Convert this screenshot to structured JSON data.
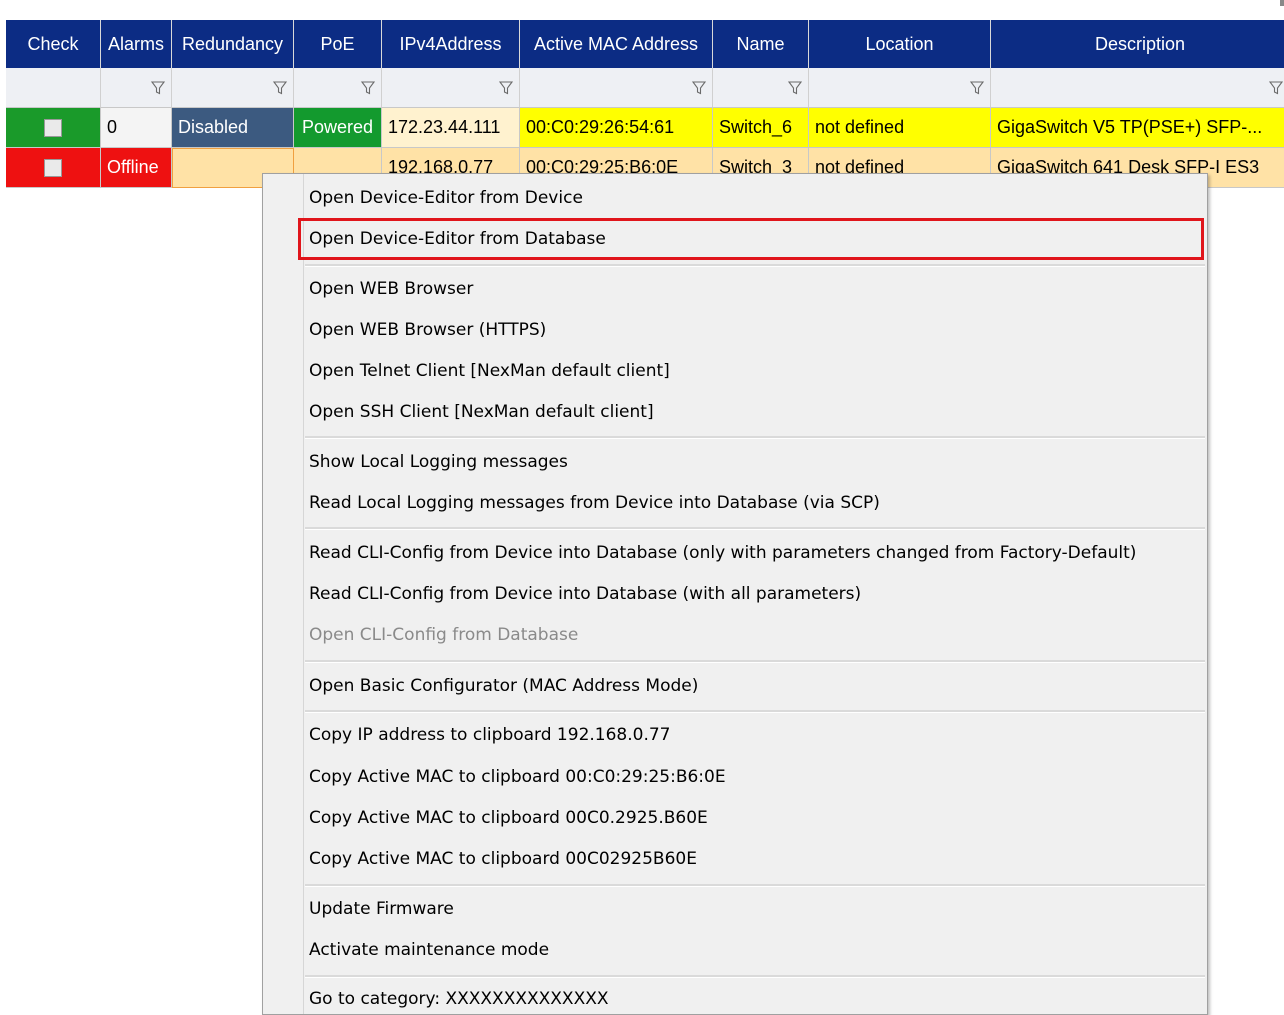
{
  "grid": {
    "columns": [
      "Check",
      "Alarms",
      "Redundancy",
      "PoE",
      "IPv4Address",
      "Active MAC Address",
      "Name",
      "Location",
      "Description"
    ],
    "rows": [
      {
        "alarms": "0",
        "redundancy": "Disabled",
        "poe": "Powered",
        "ip": "172.23.44.111",
        "mac": "00:C0:29:26:54:61",
        "name": "Switch_6",
        "location": "not defined",
        "description": "GigaSwitch V5 TP(PSE+) SFP-..."
      },
      {
        "alarms": "Offline",
        "redundancy": "",
        "poe": "",
        "ip": "192.168.0.77",
        "mac": "00:C0:29:25:B6:0E",
        "name": "Switch_3",
        "location": "not defined",
        "description": "GigaSwitch 641 Desk SFP-I ES3"
      }
    ],
    "colors": {
      "header_bg": "#0c2c84",
      "online_green": "#1a9a2a",
      "offline_red": "#ee1111",
      "highlight_yellow": "#ffff00",
      "row_orange": "#ffe2a6"
    }
  },
  "context_menu": {
    "items": [
      {
        "label": "Open Device-Editor from Device"
      },
      {
        "label": "Open Device-Editor from Database",
        "highlighted": true
      },
      {
        "label": "Open WEB Browser"
      },
      {
        "label": "Open WEB Browser (HTTPS)"
      },
      {
        "label": "Open Telnet Client [NexMan default client]"
      },
      {
        "label": "Open SSH Client [NexMan default client]"
      },
      {
        "label": "Show Local Logging messages"
      },
      {
        "label": "Read Local Logging messages from Device into Database (via SCP)"
      },
      {
        "label": "Read CLI-Config from Device into Database (only with parameters changed from Factory-Default)"
      },
      {
        "label": "Read CLI-Config from Device into Database (with all parameters)"
      },
      {
        "label": "Open CLI-Config from Database",
        "disabled": true
      },
      {
        "label": "Open Basic Configurator (MAC Address Mode)"
      },
      {
        "label": "Copy IP address to clipboard 192.168.0.77"
      },
      {
        "label": "Copy Active MAC to clipboard 00:C0:29:25:B6:0E"
      },
      {
        "label": "Copy Active MAC to clipboard 00C0.2925.B60E"
      },
      {
        "label": "Copy Active MAC to clipboard 00C02925B60E"
      },
      {
        "label": "Update Firmware"
      },
      {
        "label": "Activate maintenance mode"
      },
      {
        "label": "Go to category: XXXXXXXXXXXXXX"
      }
    ],
    "highlight_color": "#e0151b"
  }
}
